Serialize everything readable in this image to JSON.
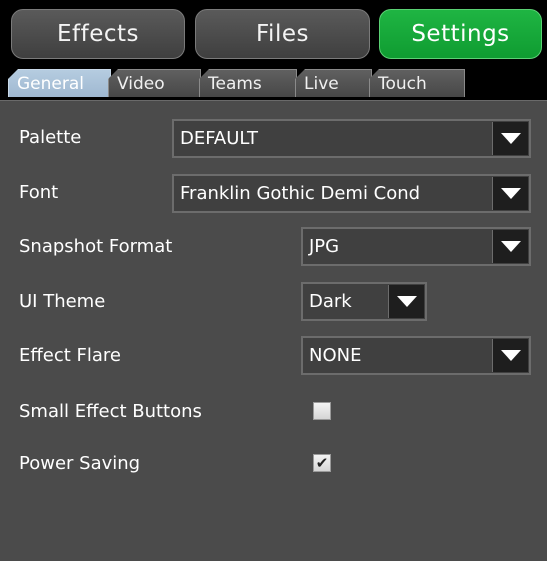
{
  "top_buttons": {
    "effects": "Effects",
    "files": "Files",
    "settings": "Settings"
  },
  "tabs": [
    {
      "label": "General",
      "active": true
    },
    {
      "label": "Video",
      "active": false
    },
    {
      "label": "Teams",
      "active": false
    },
    {
      "label": "Live",
      "active": false
    },
    {
      "label": "Touch",
      "active": false
    }
  ],
  "settings": {
    "palette": {
      "label": "Palette",
      "value": "DEFAULT"
    },
    "font": {
      "label": "Font",
      "value": "Franklin Gothic Demi Cond"
    },
    "snapshot_format": {
      "label": "Snapshot Format",
      "value": "JPG"
    },
    "ui_theme": {
      "label": "UI Theme",
      "value": "Dark"
    },
    "effect_flare": {
      "label": "Effect Flare",
      "value": "NONE"
    },
    "small_effect_buttons": {
      "label": "Small Effect Buttons",
      "checked": false
    },
    "power_saving": {
      "label": "Power Saving",
      "checked": true
    }
  },
  "colors": {
    "active_top": "#13a636",
    "active_tab": "#a9c2da",
    "panel": "#4b4b4b"
  },
  "icons": {
    "dropdown": "triangle-down-icon",
    "check": "checkmark-icon"
  }
}
